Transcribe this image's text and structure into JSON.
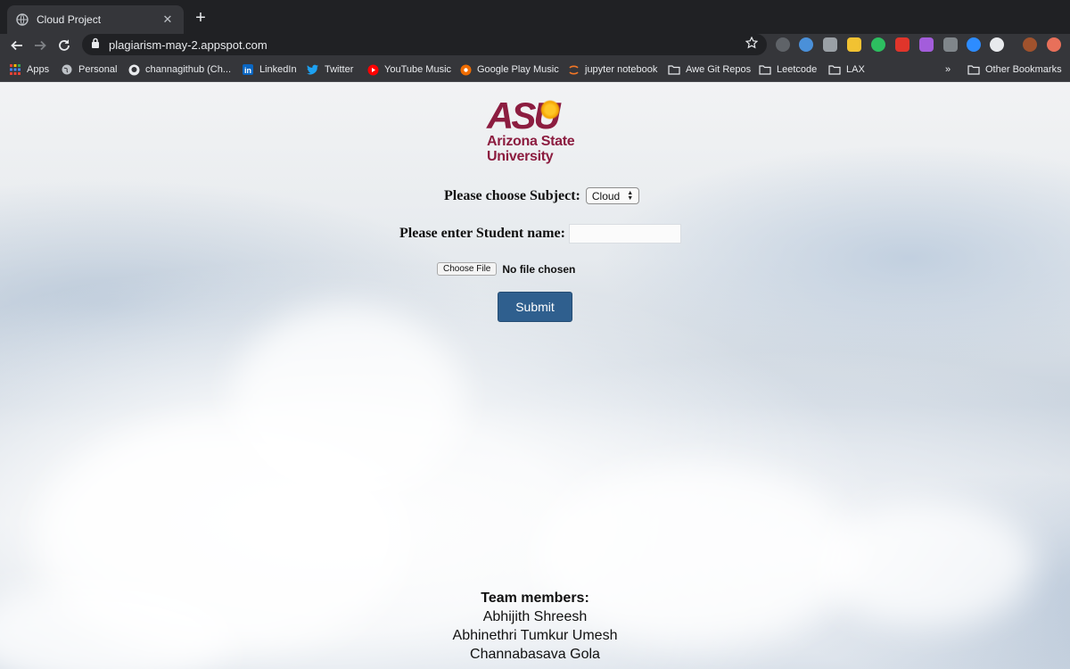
{
  "browser": {
    "tab": {
      "title": "Cloud Project",
      "close": "✕"
    },
    "new_tab": "+",
    "url": "plagiarism-may-2.appspot.com",
    "bookmarks": [
      {
        "label": "Apps",
        "icon": "apps-grid-icon"
      },
      {
        "label": "Personal",
        "icon": "globe-icon"
      },
      {
        "label": "channagithub (Ch...",
        "icon": "github-icon"
      },
      {
        "label": "LinkedIn",
        "icon": "linkedin-icon"
      },
      {
        "label": "Twitter",
        "icon": "twitter-icon"
      },
      {
        "label": "YouTube Music",
        "icon": "youtube-music-icon"
      },
      {
        "label": "Google Play Music",
        "icon": "google-play-music-icon"
      },
      {
        "label": "jupyter notebook",
        "icon": "jupyter-icon"
      },
      {
        "label": "Awe Git Repos",
        "icon": "folder-icon"
      },
      {
        "label": "Leetcode",
        "icon": "folder-icon"
      },
      {
        "label": "LAX",
        "icon": "folder-icon"
      }
    ],
    "bookmarks_overflow": "»",
    "other_bookmarks": "Other Bookmarks"
  },
  "page": {
    "logo": {
      "mark": "ASU",
      "name_line1": "Arizona State",
      "name_line2": "University"
    },
    "subject_label": "Please choose Subject:",
    "subject_value": "Cloud",
    "student_label": "Please enter Student name:",
    "student_value": "",
    "file_button": "Choose File",
    "file_status": "No file chosen",
    "submit": "Submit",
    "team_heading": "Team members:",
    "team_members": [
      "Abhijith Shreesh",
      "Abhinethri Tumkur Umesh",
      "Channabasava Gola"
    ]
  },
  "colors": {
    "asu_maroon": "#8c1d40",
    "asu_gold": "#ffc627",
    "submit_blue": "#2f5f8e",
    "chrome_dark": "#202124",
    "chrome_toolbar": "#35363a"
  }
}
